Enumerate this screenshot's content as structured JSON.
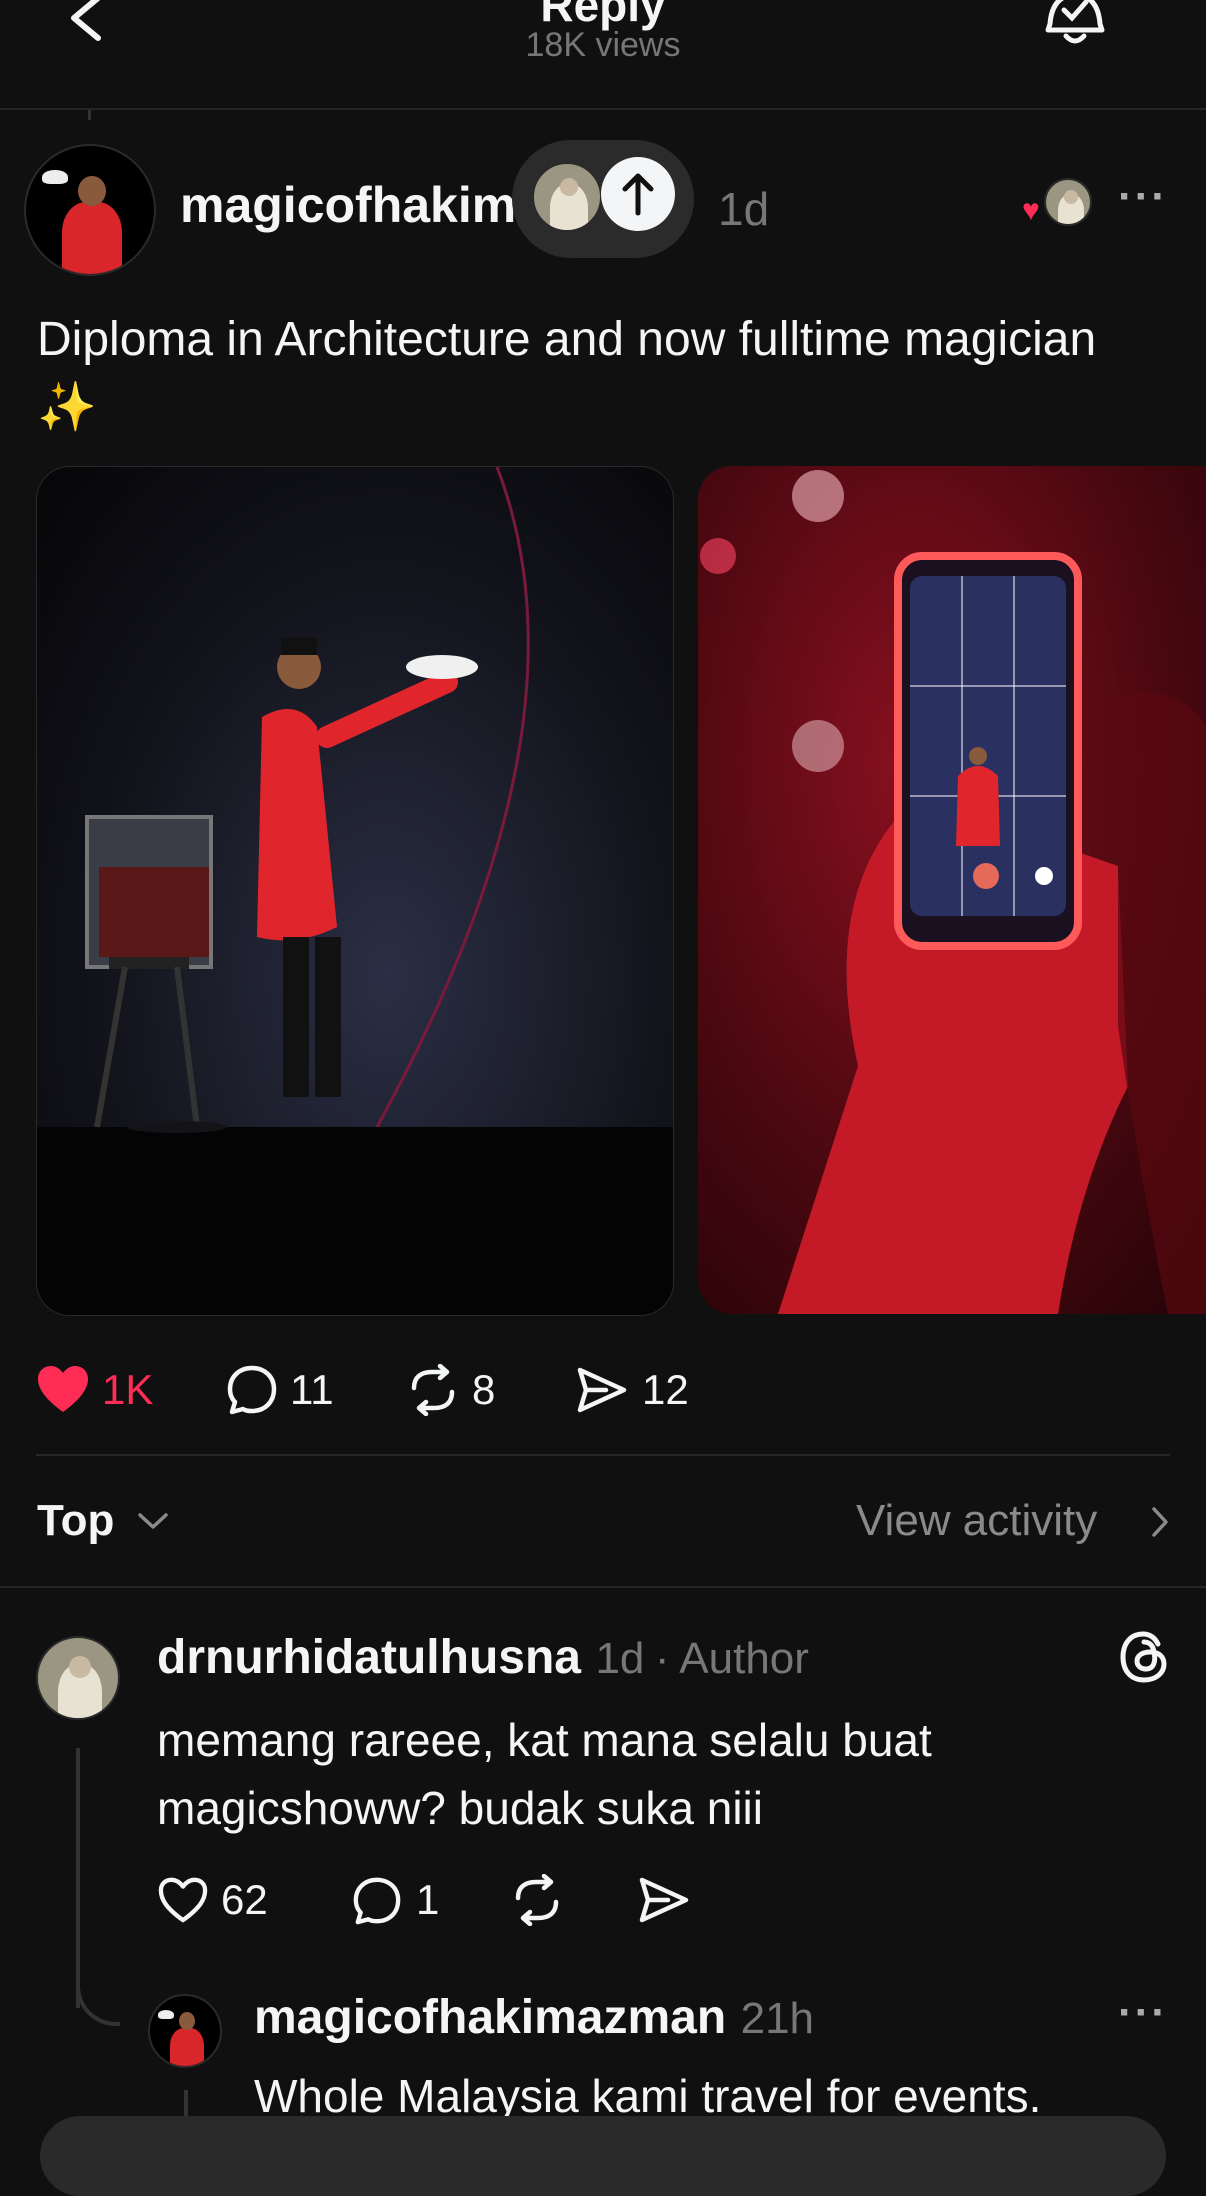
{
  "header": {
    "title": "Reply",
    "views": "18K views"
  },
  "post": {
    "username": "magicofhakimazman",
    "time": "1d",
    "caption": "Diploma in Architecture and now fulltime magician ✨",
    "likes": "1K",
    "comments": "11",
    "reposts": "8",
    "shares": "12"
  },
  "sort": {
    "label": "Top",
    "view_activity": "View activity"
  },
  "comment": {
    "username": "drnurhidatulhusna",
    "time": "1d",
    "author_badge": "· Author",
    "text": "memang rareee, kat mana selalu buat magicshoww? budak suka niii",
    "likes": "62",
    "replies": "1"
  },
  "reply": {
    "username": "magicofhakimazman",
    "time": "21h",
    "text": "Whole Malaysia kami travel for events."
  },
  "colors": {
    "like": "#ff2d55",
    "background": "#101010",
    "secondary_text": "#777777"
  },
  "icons": [
    "back-icon",
    "bell-check-icon",
    "arrow-up-icon",
    "more-icon",
    "heart-icon",
    "comment-icon",
    "repost-icon",
    "share-icon",
    "chevron-down-icon",
    "chevron-right-icon",
    "threads-logo-icon"
  ]
}
